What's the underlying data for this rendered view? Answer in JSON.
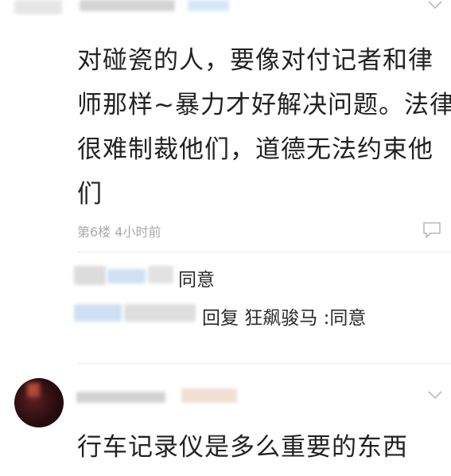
{
  "comments": [
    {
      "body_lines": [
        "对碰瓷的人，要像对付记者和律",
        "师那样~暴力才好解决问题。法律",
        "很难制裁他们，道德无法约束他",
        "们"
      ],
      "meta": "第6楼  4小时前",
      "replies": [
        {
          "text": "同意"
        },
        {
          "text": "回复 狂飙骏马 :同意"
        }
      ]
    },
    {
      "body_lines": [
        "行车记录仪是多么重要的东西"
      ]
    }
  ],
  "colors": {
    "text": "#222222",
    "meta": "#a9a9a9",
    "divider": "#ececec",
    "blur_gray": "#d8d8d8",
    "blur_blue": "#cfe3f6"
  },
  "icons": [
    "chevron-down-icon",
    "comment-reply-icon",
    "avatar"
  ]
}
